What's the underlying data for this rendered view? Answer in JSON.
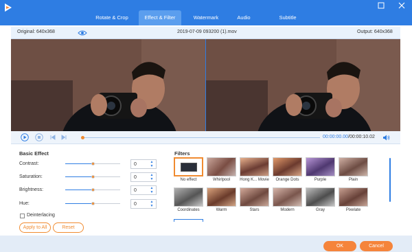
{
  "tabs": [
    "Rotate & Crop",
    "Effect & Filter",
    "Watermark",
    "Audio",
    "Subtitle"
  ],
  "active_tab": "Effect & Filter",
  "info": {
    "original": "Original: 640x368",
    "filename": "2019-07-09 093200 (1).mov",
    "output": "Output: 640x368"
  },
  "playback": {
    "current_time": "00:00:00.00",
    "separator": "/",
    "duration": "00:00:10.02",
    "progress": 0
  },
  "basic_effect": {
    "title": "Basic Effect",
    "params": [
      {
        "label": "Contrast:",
        "value": "0",
        "level": 0.5
      },
      {
        "label": "Saturation:",
        "value": "0",
        "level": 0.5
      },
      {
        "label": "Brightness:",
        "value": "0",
        "level": 0.5
      },
      {
        "label": "Hue:",
        "value": "0",
        "level": 0.5
      }
    ],
    "deinterlacing": "Deinterlacing",
    "apply_all": "Apply to All",
    "reset": "Reset"
  },
  "filters": {
    "title": "Filters",
    "items": [
      "No effect",
      "Whirlpool",
      "Hong K... Movie",
      "Orange Dots",
      "Purple",
      "Plain",
      "Coordinates",
      "Warm",
      "Stars",
      "Modern",
      "Gray",
      "Pixelate"
    ],
    "selected": "No effect"
  },
  "footer": {
    "ok": "OK",
    "cancel": "Cancel"
  },
  "colors": {
    "accent": "#2e7de3",
    "orange": "#f5843b"
  }
}
